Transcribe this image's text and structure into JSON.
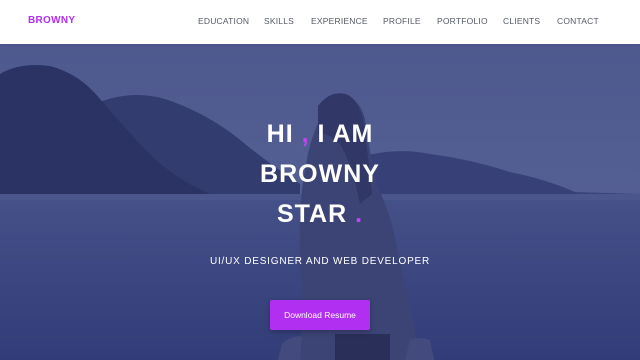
{
  "brand": "BROWNY",
  "nav": [
    {
      "label": "EDUCATION"
    },
    {
      "label": "SKILLS"
    },
    {
      "label": "EXPERIENCE"
    },
    {
      "label": "PROFILE"
    },
    {
      "label": "PORTFOLIO"
    },
    {
      "label": "CLIENTS"
    },
    {
      "label": "CONTACT"
    }
  ],
  "hero": {
    "line1_a": "HI",
    "line1_accent": ",",
    "line1_b": "I AM",
    "line2": "BROWNY",
    "line3": "STAR",
    "line3_accent": ".",
    "subtitle": "UI/UX DESIGNER AND WEB DEVELOPER",
    "cta_label": "Download Resume"
  },
  "colors": {
    "accent": "#b12ff0",
    "nav_text": "#555a66",
    "overlay": "#28306e"
  }
}
